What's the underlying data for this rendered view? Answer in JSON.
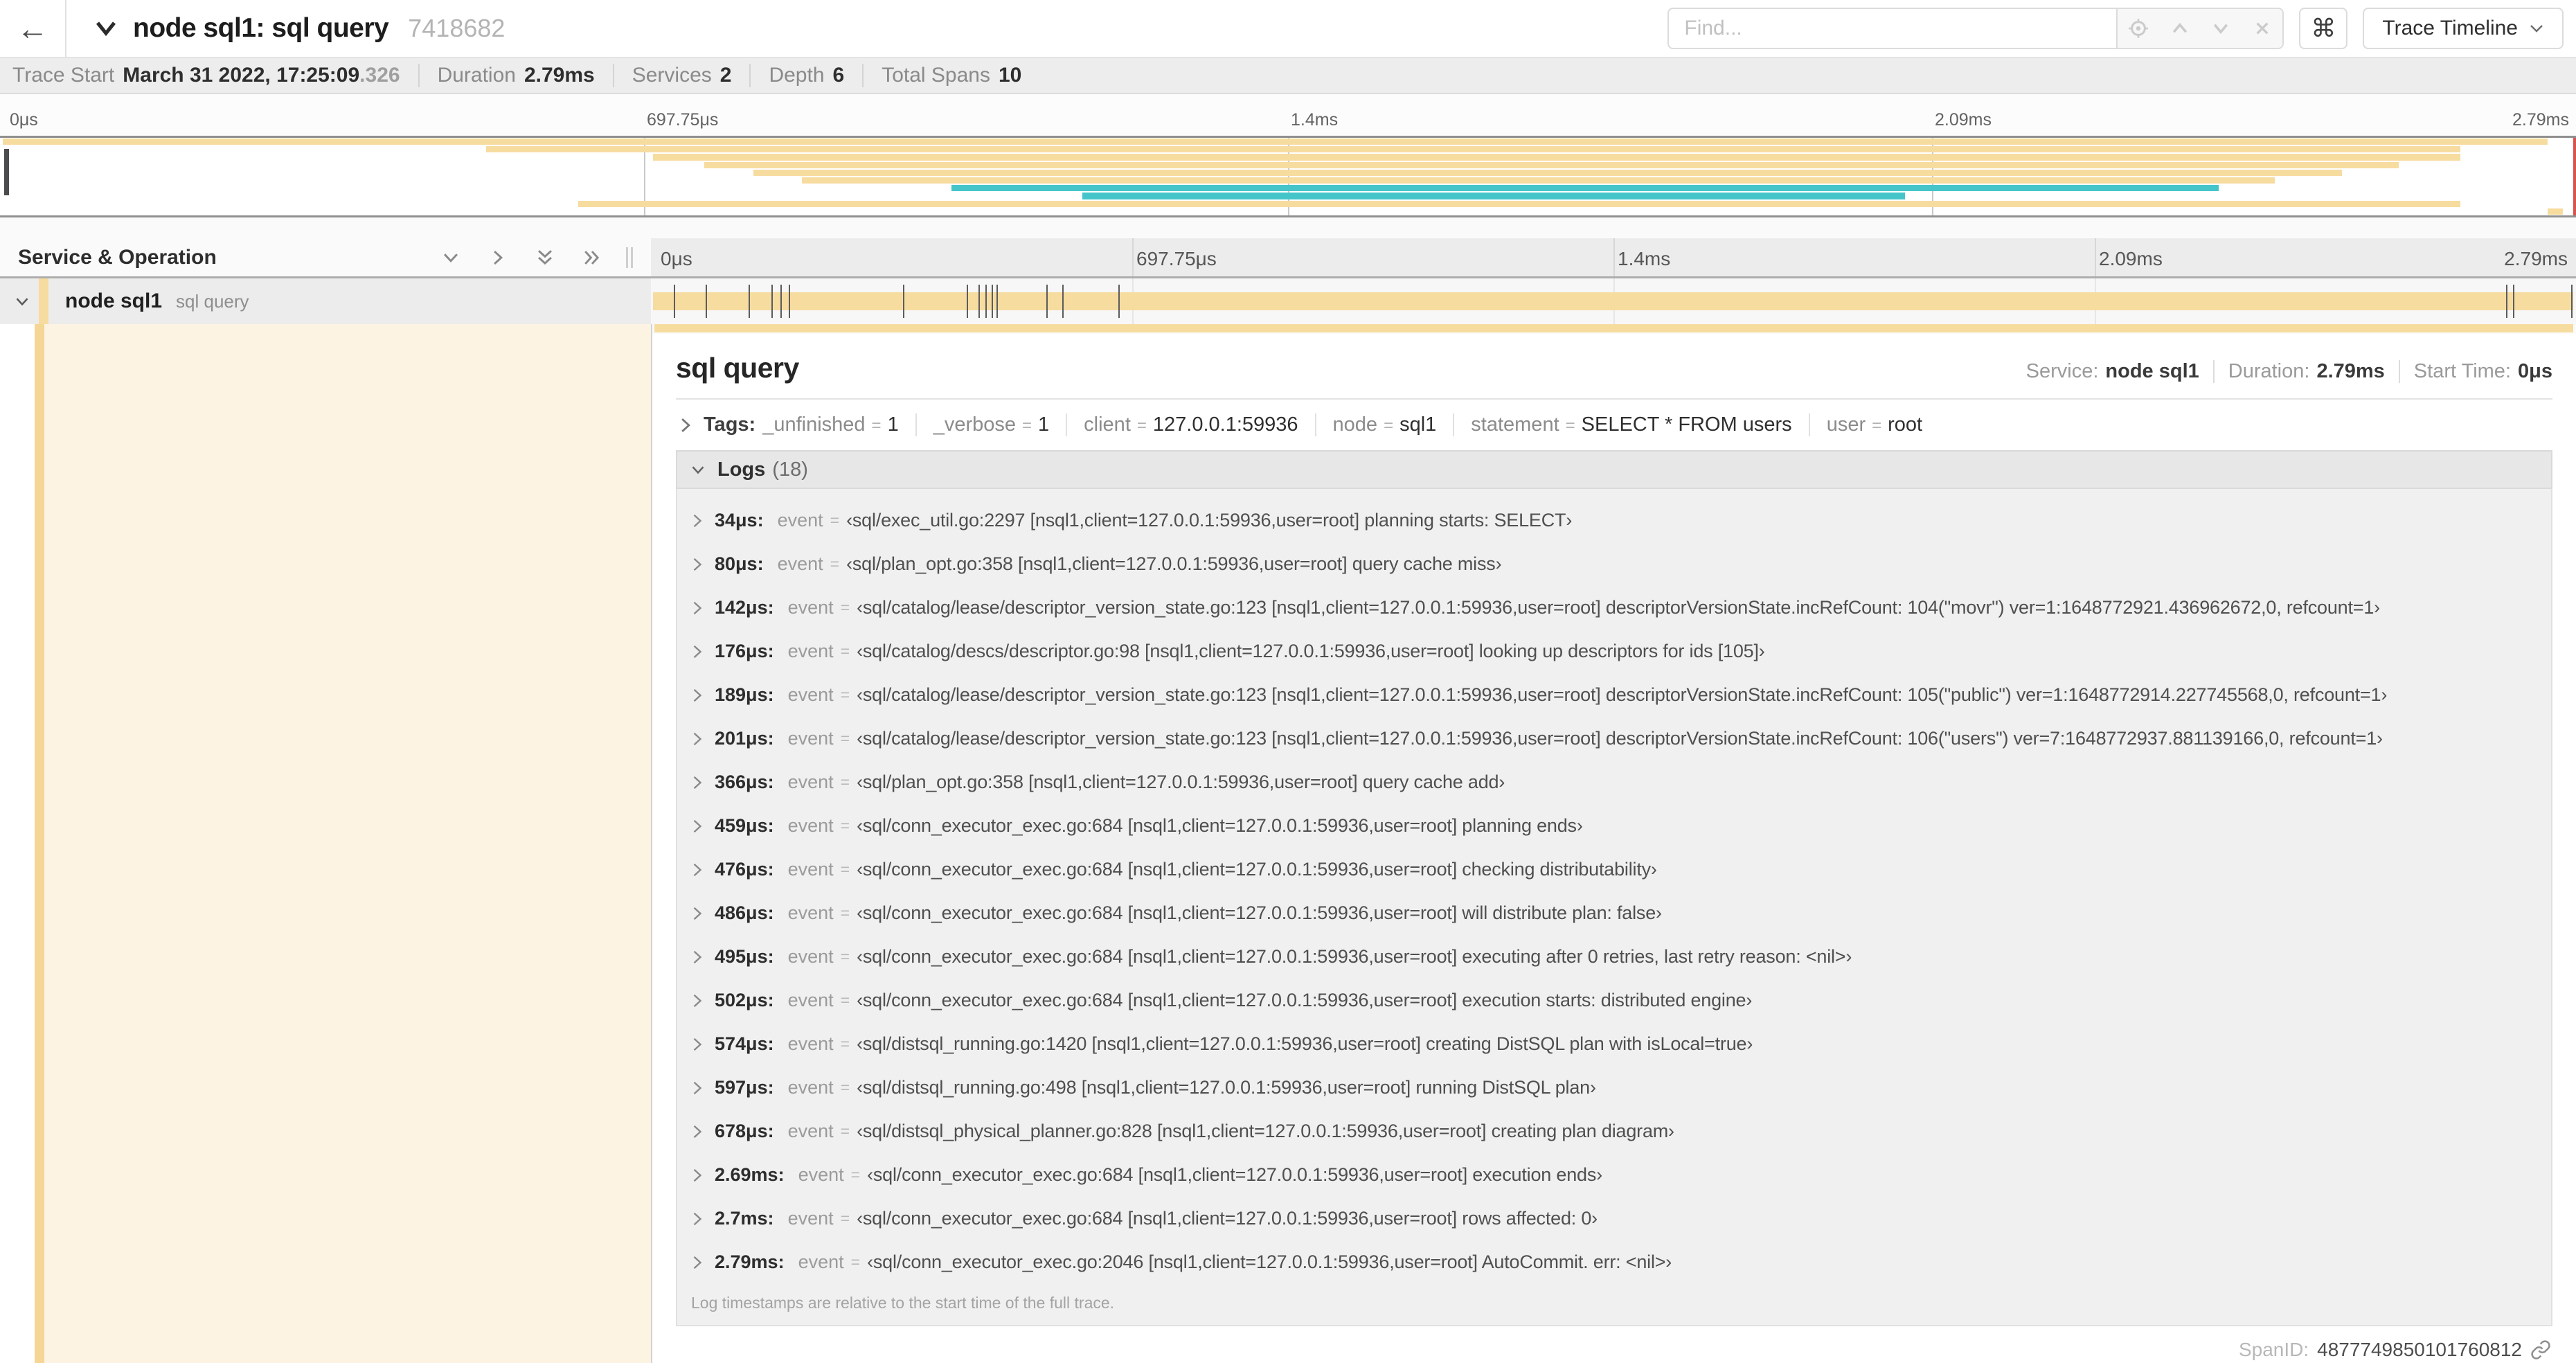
{
  "header": {
    "back_icon": "←",
    "title": "node sql1: sql query",
    "trace_id": "7418682",
    "find_placeholder": "Find...",
    "shortcut_icon": "⌘",
    "view_selector_label": "Trace Timeline"
  },
  "trace_info": {
    "items": [
      {
        "label": "Trace Start",
        "value": "March 31 2022, 17:25:09",
        "suffix": ".326"
      },
      {
        "label": "Duration",
        "value": "2.79ms",
        "suffix": ""
      },
      {
        "label": "Services",
        "value": "2",
        "suffix": ""
      },
      {
        "label": "Depth",
        "value": "6",
        "suffix": ""
      },
      {
        "label": "Total Spans",
        "value": "10",
        "suffix": ""
      }
    ]
  },
  "colors": {
    "span_tan": "#f7dca0",
    "span_teal": "#45c5ca",
    "selected_row_bg": "#ececec",
    "expanded_left_bg": "#fcf3e2",
    "minimap_scrub": "#4c4c4e",
    "minimap_edge_red": "#d9534f"
  },
  "minimap": {
    "ticks": [
      "0μs",
      "697.75μs",
      "1.4ms",
      "2.09ms",
      "2.79ms"
    ],
    "spans": [
      {
        "start": 0,
        "end": 99.0,
        "color": "tan"
      },
      {
        "start": 18.8,
        "end": 95.6,
        "color": "tan"
      },
      {
        "start": 25.3,
        "end": 95.6,
        "color": "tan"
      },
      {
        "start": 27.3,
        "end": 93.2,
        "color": "tan"
      },
      {
        "start": 29.2,
        "end": 91.0,
        "color": "tan"
      },
      {
        "start": 31.1,
        "end": 88.4,
        "color": "tan"
      },
      {
        "start": 36.9,
        "end": 86.2,
        "color": "teal"
      },
      {
        "start": 42.0,
        "end": 74.0,
        "color": "teal"
      },
      {
        "start": 22.4,
        "end": 95.6,
        "color": "tan"
      },
      {
        "start": 99.0,
        "end": 99.6,
        "color": "tan"
      }
    ]
  },
  "timeline": {
    "column_header": "Service & Operation",
    "ticks": [
      "0μs",
      "697.75μs",
      "1.4ms",
      "2.09ms",
      "2.79ms"
    ],
    "row": {
      "service": "node sql1",
      "operation": "sql query",
      "log_tick_pcts": [
        1.22,
        2.87,
        5.09,
        6.31,
        6.77,
        7.2,
        13.12,
        16.45,
        17.06,
        17.42,
        17.74,
        18.0,
        20.57,
        21.4,
        24.3,
        96.42,
        96.77,
        99.8
      ]
    }
  },
  "detail": {
    "title": "sql query",
    "overview": [
      {
        "label": "Service:",
        "value": "node sql1"
      },
      {
        "label": "Duration:",
        "value": "2.79ms"
      },
      {
        "label": "Start Time:",
        "value": "0μs"
      }
    ],
    "tags": {
      "label": "Tags:",
      "items": [
        {
          "key": "_unfinished",
          "value": "1"
        },
        {
          "key": "_verbose",
          "value": "1"
        },
        {
          "key": "client",
          "value": "127.0.0.1:59936"
        },
        {
          "key": "node",
          "value": "sql1"
        },
        {
          "key": "statement",
          "value": "SELECT * FROM users"
        },
        {
          "key": "user",
          "value": "root"
        }
      ]
    },
    "logs": {
      "label": "Logs",
      "count": "(18)",
      "entries": [
        {
          "time": "34μs:",
          "key": "event",
          "value": "‹sql/exec_util.go:2297 [nsql1,client=127.0.0.1:59936,user=root] planning starts: SELECT›"
        },
        {
          "time": "80μs:",
          "key": "event",
          "value": "‹sql/plan_opt.go:358 [nsql1,client=127.0.0.1:59936,user=root] query cache miss›"
        },
        {
          "time": "142μs:",
          "key": "event",
          "value": "‹sql/catalog/lease/descriptor_version_state.go:123 [nsql1,client=127.0.0.1:59936,user=root] descriptorVersionState.incRefCount: 104(\"movr\") ver=1:1648772921.436962672,0, refcount=1›"
        },
        {
          "time": "176μs:",
          "key": "event",
          "value": "‹sql/catalog/descs/descriptor.go:98 [nsql1,client=127.0.0.1:59936,user=root] looking up descriptors for ids [105]›"
        },
        {
          "time": "189μs:",
          "key": "event",
          "value": "‹sql/catalog/lease/descriptor_version_state.go:123 [nsql1,client=127.0.0.1:59936,user=root] descriptorVersionState.incRefCount: 105(\"public\") ver=1:1648772914.227745568,0, refcount=1›"
        },
        {
          "time": "201μs:",
          "key": "event",
          "value": "‹sql/catalog/lease/descriptor_version_state.go:123 [nsql1,client=127.0.0.1:59936,user=root] descriptorVersionState.incRefCount: 106(\"users\") ver=7:1648772937.881139166,0, refcount=1›"
        },
        {
          "time": "366μs:",
          "key": "event",
          "value": "‹sql/plan_opt.go:358 [nsql1,client=127.0.0.1:59936,user=root] query cache add›"
        },
        {
          "time": "459μs:",
          "key": "event",
          "value": "‹sql/conn_executor_exec.go:684 [nsql1,client=127.0.0.1:59936,user=root] planning ends›"
        },
        {
          "time": "476μs:",
          "key": "event",
          "value": "‹sql/conn_executor_exec.go:684 [nsql1,client=127.0.0.1:59936,user=root] checking distributability›"
        },
        {
          "time": "486μs:",
          "key": "event",
          "value": "‹sql/conn_executor_exec.go:684 [nsql1,client=127.0.0.1:59936,user=root] will distribute plan: false›"
        },
        {
          "time": "495μs:",
          "key": "event",
          "value": "‹sql/conn_executor_exec.go:684 [nsql1,client=127.0.0.1:59936,user=root] executing after 0 retries, last retry reason: <nil>›"
        },
        {
          "time": "502μs:",
          "key": "event",
          "value": "‹sql/conn_executor_exec.go:684 [nsql1,client=127.0.0.1:59936,user=root] execution starts: distributed engine›"
        },
        {
          "time": "574μs:",
          "key": "event",
          "value": "‹sql/distsql_running.go:1420 [nsql1,client=127.0.0.1:59936,user=root] creating DistSQL plan with isLocal=true›"
        },
        {
          "time": "597μs:",
          "key": "event",
          "value": "‹sql/distsql_running.go:498 [nsql1,client=127.0.0.1:59936,user=root] running DistSQL plan›"
        },
        {
          "time": "678μs:",
          "key": "event",
          "value": "‹sql/distsql_physical_planner.go:828 [nsql1,client=127.0.0.1:59936,user=root] creating plan diagram›"
        },
        {
          "time": "2.69ms:",
          "key": "event",
          "value": "‹sql/conn_executor_exec.go:684 [nsql1,client=127.0.0.1:59936,user=root] execution ends›"
        },
        {
          "time": "2.7ms:",
          "key": "event",
          "value": "‹sql/conn_executor_exec.go:684 [nsql1,client=127.0.0.1:59936,user=root] rows affected: 0›"
        },
        {
          "time": "2.79ms:",
          "key": "event",
          "value": "‹sql/conn_executor_exec.go:2046 [nsql1,client=127.0.0.1:59936,user=root] AutoCommit. err: <nil>›"
        }
      ],
      "footer": "Log timestamps are relative to the start time of the full trace."
    },
    "span_id_label": "SpanID:",
    "span_id": "4877749850101760812"
  }
}
